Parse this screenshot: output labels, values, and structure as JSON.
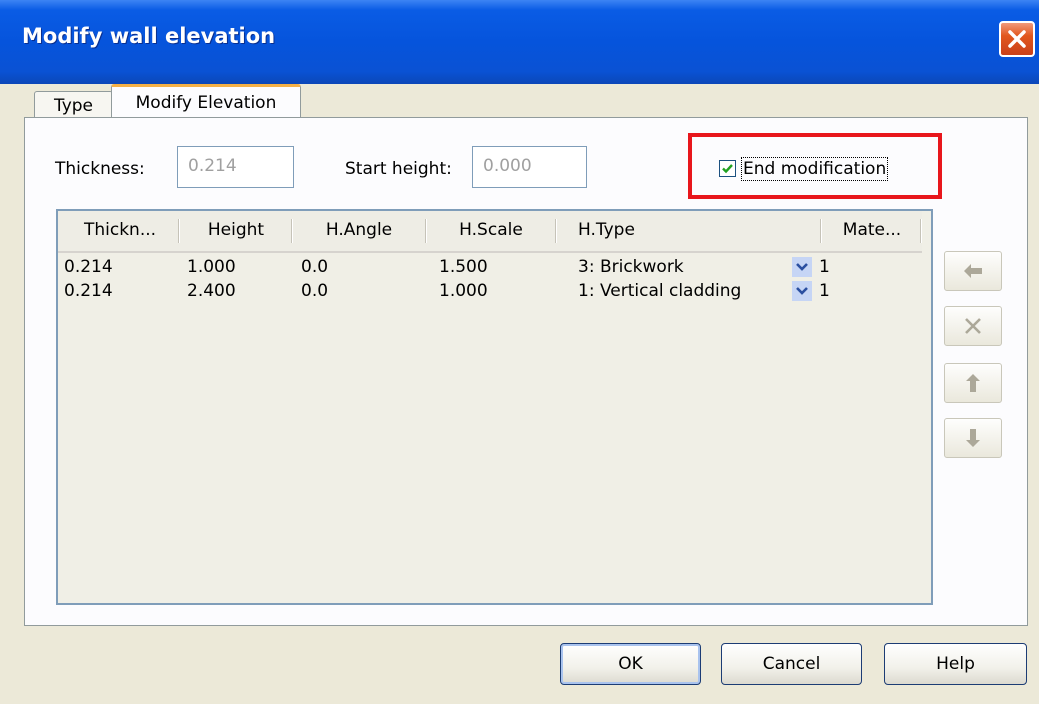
{
  "window": {
    "title": "Modify wall elevation"
  },
  "tabs": [
    {
      "label": "Type"
    },
    {
      "label": "Modify Elevation"
    }
  ],
  "fields": {
    "thickness_label": "Thickness:",
    "thickness_value": "0.214",
    "start_height_label": "Start height:",
    "start_height_value": "0.000"
  },
  "end_modification": {
    "label": "End modification",
    "checked": true
  },
  "grid": {
    "columns": [
      "Thickn...",
      "Height",
      "H.Angle",
      "H.Scale",
      "H.Type",
      "Mate..."
    ],
    "rows": [
      {
        "thickness": "0.214",
        "height": "1.000",
        "angle": "0.0",
        "scale": "1.500",
        "type": "3: Brickwork",
        "material": "1"
      },
      {
        "thickness": "0.214",
        "height": "2.400",
        "angle": "0.0",
        "scale": "1.000",
        "type": "1: Vertical cladding",
        "material": "1"
      }
    ]
  },
  "side_buttons": [
    {
      "icon": "arrow-left-icon"
    },
    {
      "icon": "delete-x-icon"
    },
    {
      "icon": "arrow-up-icon"
    },
    {
      "icon": "arrow-down-icon"
    }
  ],
  "buttons": {
    "ok": "OK",
    "cancel": "Cancel",
    "help": "Help"
  },
  "colors": {
    "titlebar": "#0654dc",
    "highlight": "#e8161c",
    "tab_accent": "#f5b046"
  }
}
